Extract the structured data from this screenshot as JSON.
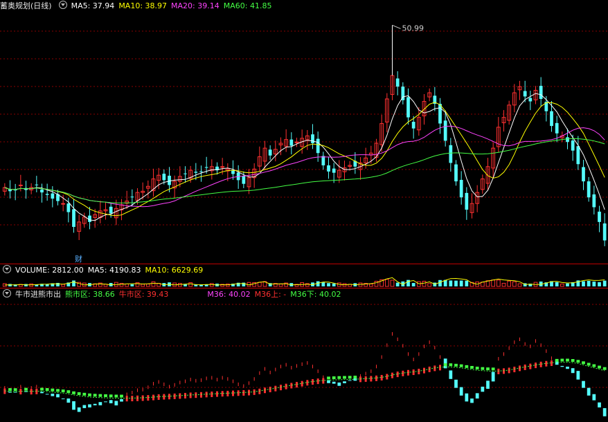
{
  "panels": {
    "price": {
      "title": "蓄奥规划(日线)",
      "ma": [
        {
          "label": "MA5: 37.94",
          "color": "#ffffff"
        },
        {
          "label": "MA10: 38.97",
          "color": "#ffff00"
        },
        {
          "label": "MA20: 39.14",
          "color": "#ff44ff"
        },
        {
          "label": "MA60: 41.85",
          "color": "#44ff44"
        }
      ],
      "peak_label": "50.99",
      "news_badge": "财"
    },
    "volume": {
      "items": [
        {
          "label": "VOLUME: 2812.00",
          "color": "#ffffff"
        },
        {
          "label": "MA5: 4190.83",
          "color": "#ffffff"
        },
        {
          "label": "MA10: 6629.69",
          "color": "#ffff00"
        }
      ]
    },
    "indicator": {
      "title": "牛市进熊市出",
      "items": [
        {
          "label": "熊市区: 38.66",
          "color": "#44ff44"
        },
        {
          "label": "牛市区: 39.43",
          "color": "#ff3030"
        },
        {
          "label": "M36: 40.02",
          "color": "#ff44ff"
        },
        {
          "label": "M36上: -",
          "color": "#ff3030"
        },
        {
          "label": "M36下: 40.02",
          "color": "#44ff44"
        }
      ]
    }
  },
  "colors": {
    "up": "#ff3030",
    "down": "#54fcfc",
    "ma5": "#ffffff",
    "ma10": "#ffff00",
    "ma20": "#ff44ff",
    "ma60": "#44ff44",
    "grid": "#8b0000",
    "separator": "#c00000"
  },
  "chart_data": {
    "type": "candlestick",
    "closes": [
      37.8,
      37.5,
      37.6,
      38.0,
      37.6,
      37.8,
      38.0,
      37.4,
      37.2,
      36.9,
      36.7,
      36.5,
      35.8,
      34.6,
      35.0,
      35.4,
      35.0,
      35.6,
      35.9,
      36.0,
      35.7,
      36.1,
      36.4,
      36.7,
      37.0,
      37.4,
      37.5,
      37.9,
      38.5,
      38.8,
      38.4,
      38.0,
      38.3,
      38.7,
      38.9,
      39.2,
      39.0,
      39.1,
      39.4,
      39.5,
      39.2,
      39.5,
      39.3,
      38.9,
      38.4,
      38.1,
      38.6,
      39.3,
      40.3,
      41.0,
      40.4,
      40.9,
      41.4,
      41.7,
      41.2,
      41.5,
      41.8,
      42.0,
      41.4,
      40.6,
      39.6,
      39.1,
      39.0,
      39.2,
      39.4,
      39.6,
      39.5,
      39.8,
      40.2,
      40.6,
      41.4,
      43.0,
      45.0,
      46.9,
      46.0,
      44.9,
      43.5,
      42.6,
      43.5,
      44.8,
      45.5,
      44.6,
      43.0,
      41.6,
      39.8,
      38.3,
      37.0,
      36.0,
      36.5,
      37.4,
      38.5,
      39.5,
      41.0,
      42.7,
      43.5,
      44.5,
      45.5,
      46.0,
      45.2,
      44.8,
      45.7,
      45.0,
      44.0,
      42.8,
      42.2,
      42.0,
      41.5,
      40.8,
      39.7,
      38.3,
      37.0,
      36.2,
      35.0,
      33.5
    ],
    "peak_high": 50.99,
    "ylim": [
      32.8,
      51.8
    ],
    "volume": {
      "values": [
        2812.0
      ],
      "ma5": 4190.83,
      "ma10": 6629.69
    },
    "indicator_latest": {
      "熊市区": 38.66,
      "牛市区": 39.43,
      "M36": 40.02,
      "M36下": 40.02
    }
  }
}
